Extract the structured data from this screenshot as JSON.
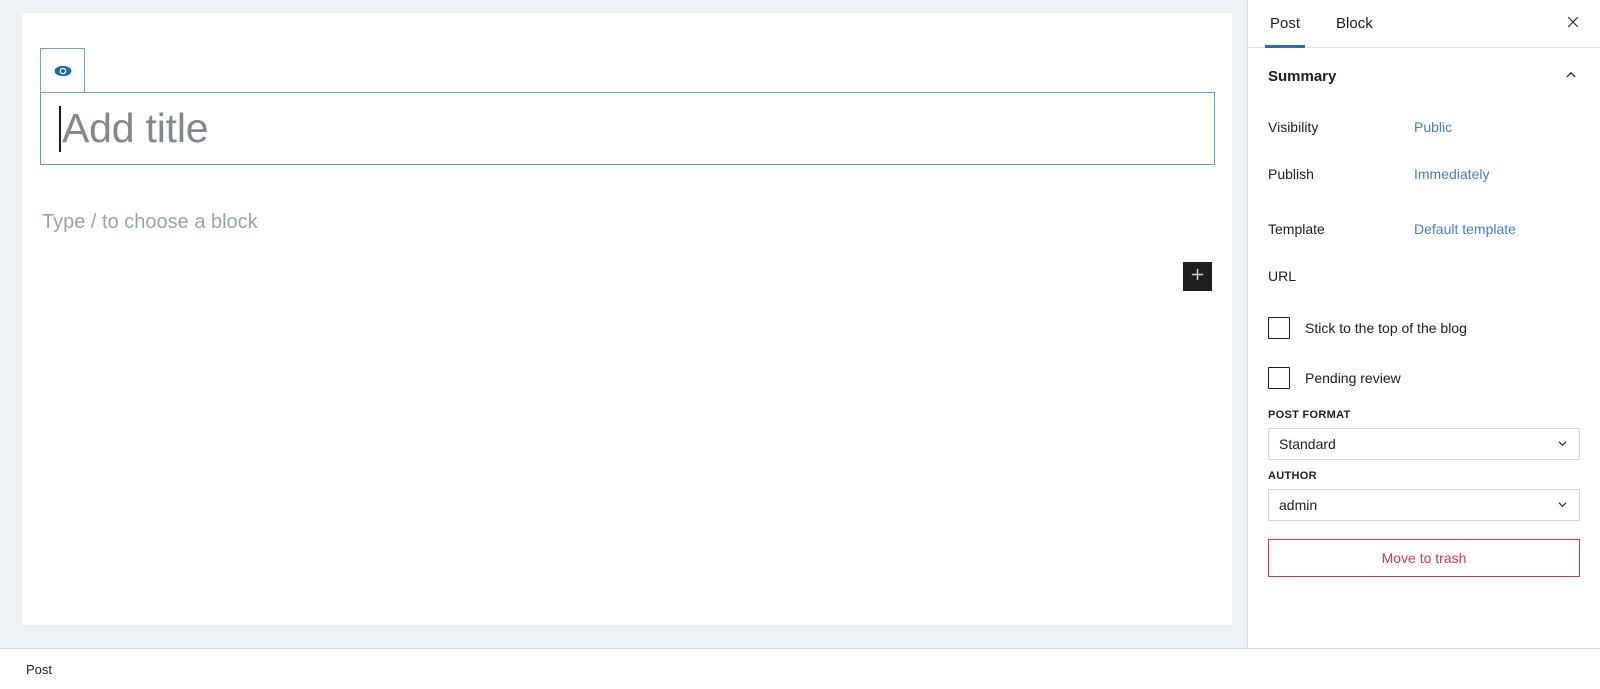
{
  "editor": {
    "view_post_icon": "eye-icon",
    "title_placeholder": "Add title",
    "block_placeholder": "Type / to choose a block",
    "add_block_icon": "plus-icon",
    "accent_blue": "#5b9bd0"
  },
  "sidebar": {
    "tabs": [
      {
        "label": "Post",
        "active": true
      },
      {
        "label": "Block",
        "active": false
      }
    ],
    "close_icon": "close-icon",
    "summary": {
      "title": "Summary",
      "collapse_icon": "chevron-up-icon",
      "rows": [
        {
          "label": "Visibility",
          "value": "Public"
        },
        {
          "label": "Publish",
          "value": "Immediately"
        },
        {
          "label": "Template",
          "value": "Default template"
        },
        {
          "label": "URL",
          "value": ""
        }
      ]
    },
    "checkboxes": [
      {
        "label": "Stick to the top of the blog",
        "checked": false
      },
      {
        "label": "Pending review",
        "checked": false
      }
    ],
    "post_format": {
      "label": "POST FORMAT",
      "value": "Standard",
      "chevron_icon": "chevron-down-icon"
    },
    "author": {
      "label": "AUTHOR",
      "value": "admin",
      "chevron_icon": "chevron-down-icon"
    },
    "trash_button": {
      "label": "Move to trash",
      "color": "#cc3c3f"
    },
    "link_color": "#4b7cc0",
    "active_tab_underline": "#2b6cb8"
  },
  "footer": {
    "label": "Post"
  }
}
